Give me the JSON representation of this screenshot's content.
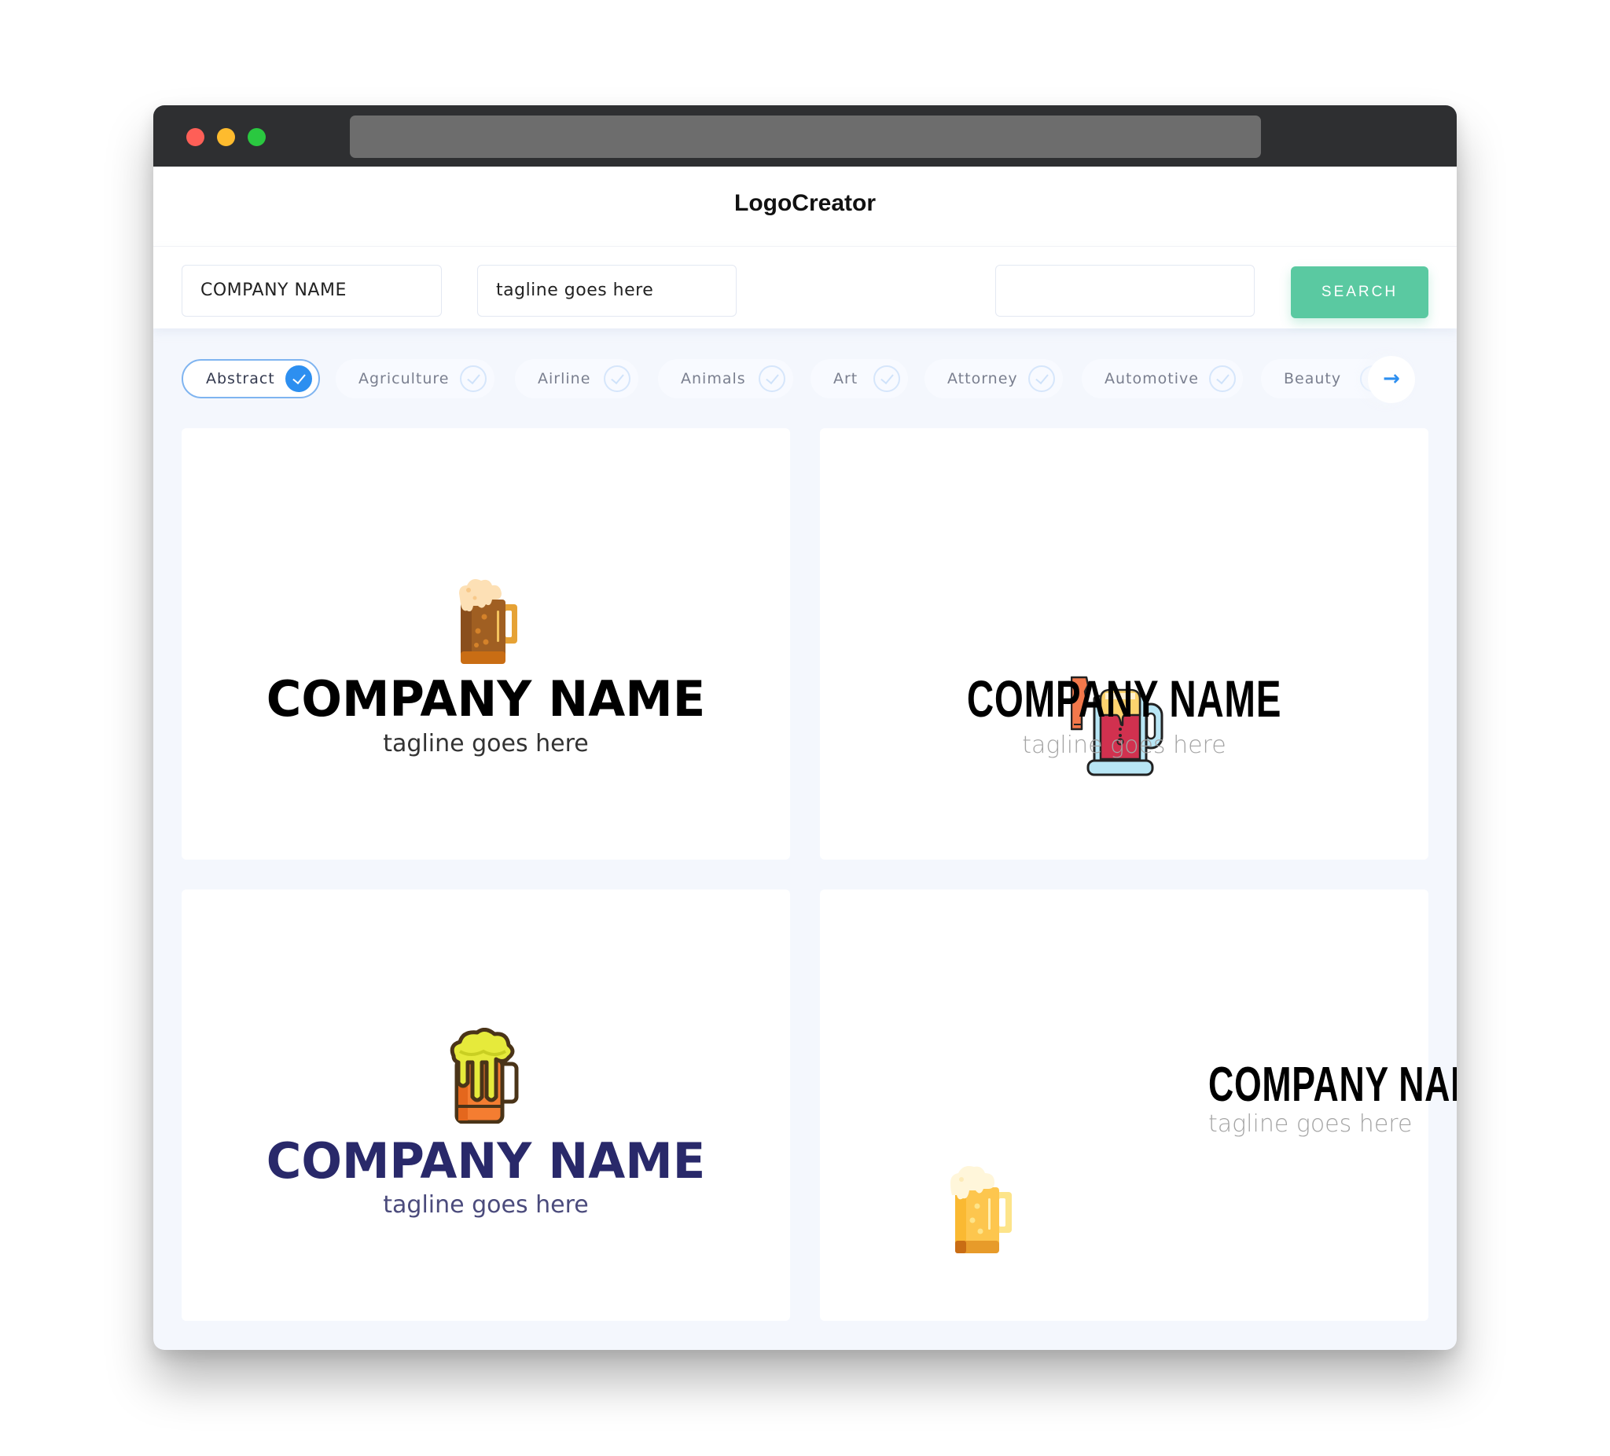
{
  "window": {
    "controls": [
      "close",
      "minimize",
      "maximize"
    ],
    "url": ""
  },
  "header": {
    "title": "LogoCreator"
  },
  "search": {
    "company_name_value": "COMPANY NAME",
    "tagline_value": "tagline goes here",
    "keyword_value": "",
    "search_label": "SEARCH"
  },
  "categories": {
    "items": [
      {
        "label": "Abstract",
        "selected": true
      },
      {
        "label": "Agriculture",
        "selected": false
      },
      {
        "label": "Airline",
        "selected": false
      },
      {
        "label": "Animals",
        "selected": false
      },
      {
        "label": "Art",
        "selected": false
      },
      {
        "label": "Attorney",
        "selected": false
      },
      {
        "label": "Automotive",
        "selected": false
      },
      {
        "label": "Beauty",
        "selected": false
      }
    ],
    "next_icon": "arrow-right-icon"
  },
  "logos": [
    {
      "company_name": "COMPANY NAME",
      "tagline": "tagline goes here",
      "icon": "beer-mug-brown-icon",
      "name_color": "#000000",
      "tagline_color": "#333333"
    },
    {
      "company_name": "COMPANY NAME",
      "tagline": "tagline goes here",
      "icon": "beer-tankard-red-icon",
      "name_color": "#000000",
      "tagline_color": "#a4a4a4"
    },
    {
      "company_name": "COMPANY NAME",
      "tagline": "tagline goes here",
      "icon": "beer-mug-orange-icon",
      "name_color": "#29296a",
      "tagline_color": "#4b4b7c"
    },
    {
      "company_name": "COMPANY NAME",
      "tagline": "tagline goes here",
      "icon": "beer-mug-yellow-icon",
      "name_color": "#000000",
      "tagline_color": "#a4a4a4"
    }
  ],
  "colors": {
    "accent": "#2d8ff0",
    "search_button": "#5ac9a1",
    "titlebar": "#2e2f31",
    "page_background": "#f4f7fd"
  }
}
